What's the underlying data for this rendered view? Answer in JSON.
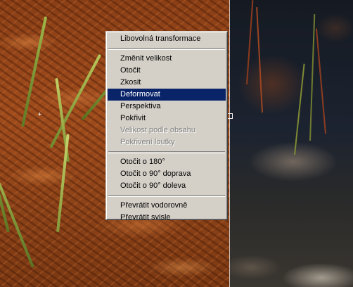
{
  "context_menu": {
    "groups": [
      [
        {
          "label": "Libovolná transformace",
          "state": "normal"
        }
      ],
      [
        {
          "label": "Změnit velikost",
          "state": "normal"
        },
        {
          "label": "Otočit",
          "state": "normal"
        },
        {
          "label": "Zkosit",
          "state": "normal"
        },
        {
          "label": "Deformovat",
          "state": "selected"
        },
        {
          "label": "Perspektiva",
          "state": "normal"
        },
        {
          "label": "Pokřivit",
          "state": "normal"
        },
        {
          "label": "Velikost podle obsahu",
          "state": "disabled"
        },
        {
          "label": "Pokřivení loutky",
          "state": "disabled"
        }
      ],
      [
        {
          "label": "Otočit o 180°",
          "state": "normal"
        },
        {
          "label": "Otočit o 90° doprava",
          "state": "normal"
        },
        {
          "label": "Otočit o 90° doleva",
          "state": "normal"
        }
      ],
      [
        {
          "label": "Převrátit vodorovně",
          "state": "normal"
        },
        {
          "label": "Převrátit svisle",
          "state": "normal"
        }
      ]
    ]
  },
  "colors": {
    "menu_background": "#d4d0c8",
    "menu_highlight": "#0a246a",
    "menu_highlight_text": "#ffffff",
    "menu_disabled_text": "#808080"
  },
  "icons": {
    "transform_center": "crosshair-icon",
    "transform_handle": "square-handle-icon"
  }
}
